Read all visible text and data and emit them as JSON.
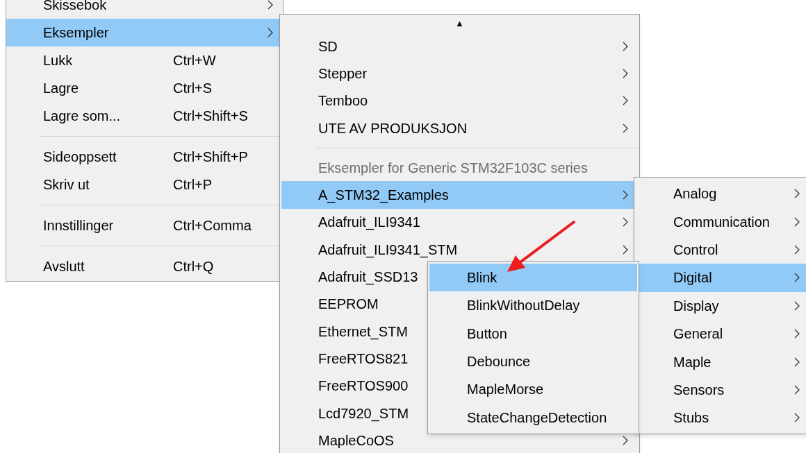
{
  "menus": [
    {
      "items": [
        {
          "kind": "item",
          "label": "Skissebok",
          "submenu": true,
          "selected": false
        },
        {
          "kind": "item",
          "label": "Eksempler",
          "submenu": true,
          "selected": true
        },
        {
          "kind": "item",
          "label": "Lukk",
          "shortcut": "Ctrl+W",
          "submenu": false,
          "selected": false
        },
        {
          "kind": "item",
          "label": "Lagre",
          "shortcut": "Ctrl+S",
          "submenu": false,
          "selected": false
        },
        {
          "kind": "item",
          "label": "Lagre som...",
          "shortcut": "Ctrl+Shift+S",
          "submenu": false,
          "selected": false
        },
        {
          "kind": "separator"
        },
        {
          "kind": "item",
          "label": "Sideoppsett",
          "shortcut": "Ctrl+Shift+P",
          "submenu": false,
          "selected": false
        },
        {
          "kind": "item",
          "label": "Skriv ut",
          "shortcut": "Ctrl+P",
          "submenu": false,
          "selected": false
        },
        {
          "kind": "separator"
        },
        {
          "kind": "item",
          "label": "Innstillinger",
          "shortcut": "Ctrl+Comma",
          "submenu": false,
          "selected": false
        },
        {
          "kind": "separator"
        },
        {
          "kind": "item",
          "label": "Avslutt",
          "shortcut": "Ctrl+Q",
          "submenu": false,
          "selected": false
        }
      ]
    },
    {
      "scroll_up": "▲",
      "items": [
        {
          "kind": "item",
          "label": "SD",
          "submenu": true,
          "selected": false
        },
        {
          "kind": "item",
          "label": "Stepper",
          "submenu": true,
          "selected": false
        },
        {
          "kind": "item",
          "label": "Temboo",
          "submenu": true,
          "selected": false
        },
        {
          "kind": "item",
          "label": "UTE AV PRODUKSJON",
          "submenu": true,
          "selected": false
        },
        {
          "kind": "separator"
        },
        {
          "kind": "header",
          "label": "Eksempler for Generic STM32F103C series"
        },
        {
          "kind": "item",
          "label": "A_STM32_Examples",
          "submenu": true,
          "selected": true
        },
        {
          "kind": "item",
          "label": "Adafruit_ILI9341",
          "submenu": true,
          "selected": false
        },
        {
          "kind": "item",
          "label": "Adafruit_ILI9341_STM",
          "submenu": true,
          "selected": false
        },
        {
          "kind": "item",
          "label": "Adafruit_SSD13",
          "submenu": false,
          "selected": false
        },
        {
          "kind": "item",
          "label": "EEPROM",
          "submenu": false,
          "selected": false
        },
        {
          "kind": "item",
          "label": "Ethernet_STM",
          "submenu": false,
          "selected": false
        },
        {
          "kind": "item",
          "label": "FreeRTOS821",
          "submenu": false,
          "selected": false
        },
        {
          "kind": "item",
          "label": "FreeRTOS900",
          "submenu": false,
          "selected": false
        },
        {
          "kind": "item",
          "label": "Lcd7920_STM",
          "submenu": false,
          "selected": false
        },
        {
          "kind": "item",
          "label": "MapleCoOS",
          "submenu": true,
          "selected": false
        }
      ]
    },
    {
      "items": [
        {
          "kind": "item",
          "label": "Blink",
          "submenu": false,
          "selected": true
        },
        {
          "kind": "item",
          "label": "BlinkWithoutDelay",
          "submenu": false,
          "selected": false
        },
        {
          "kind": "item",
          "label": "Button",
          "submenu": false,
          "selected": false
        },
        {
          "kind": "item",
          "label": "Debounce",
          "submenu": false,
          "selected": false
        },
        {
          "kind": "item",
          "label": "MapleMorse",
          "submenu": false,
          "selected": false
        },
        {
          "kind": "item",
          "label": "StateChangeDetection",
          "submenu": false,
          "selected": false
        }
      ]
    },
    {
      "items": [
        {
          "kind": "item",
          "label": "Analog",
          "submenu": true,
          "selected": false
        },
        {
          "kind": "item",
          "label": "Communication",
          "submenu": true,
          "selected": false
        },
        {
          "kind": "item",
          "label": "Control",
          "submenu": true,
          "selected": false
        },
        {
          "kind": "item",
          "label": "Digital",
          "submenu": true,
          "selected": true
        },
        {
          "kind": "item",
          "label": "Display",
          "submenu": true,
          "selected": false
        },
        {
          "kind": "item",
          "label": "General",
          "submenu": true,
          "selected": false
        },
        {
          "kind": "item",
          "label": "Maple",
          "submenu": true,
          "selected": false
        },
        {
          "kind": "item",
          "label": "Sensors",
          "submenu": true,
          "selected": false
        },
        {
          "kind": "item",
          "label": "Stubs",
          "submenu": true,
          "selected": false
        }
      ]
    }
  ]
}
